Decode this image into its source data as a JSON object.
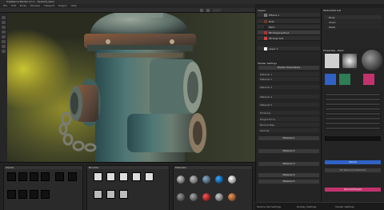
{
  "window": {
    "title": "Substance Painter 2.1.1 - Hydrant_steel"
  },
  "menu": [
    "File",
    "Edit",
    "Mode",
    "Window",
    "Viewport",
    "Plugins",
    "Help"
  ],
  "layers": {
    "title": "Layers",
    "items": [
      {
        "label": "Effects 1"
      },
      {
        "label": "Rust"
      },
      {
        "label": "Paint"
      },
      {
        "label": "PE Dripping Rust"
      },
      {
        "label": "PE Dust Dirt"
      },
      {
        "label": "Layer 1"
      }
    ]
  },
  "texture_set": {
    "title": "TextureSet List",
    "items": [
      "Body",
      "Chain",
      "Pedel"
    ]
  },
  "shader": {
    "title": "Shader Settings",
    "name": "Shader Parameters",
    "sections": [
      "Material 1",
      "Material 2",
      "Material 3",
      "Material 4",
      "Material 5"
    ],
    "rows": [
      "Material 1",
      "Material 2",
      "Material 3",
      "Material 4",
      "Material 5",
      "Emissive",
      "Height Force",
      "Normal Map",
      "Opacity"
    ]
  },
  "properties": {
    "title": "Properties - Paint",
    "button_blue": "Stencil",
    "button_alt": "No Resource Selected",
    "button_pink": "Normal/Height",
    "color_swatches": {
      "blue": "#2f62c4",
      "pink": "#c2336e",
      "green": "#2e7d54"
    }
  },
  "shelf": {
    "title": "Shelf",
    "tabs": [
      "Alphas",
      "Brushes",
      "Materials",
      "Smart materials"
    ]
  },
  "status_tabs": [
    "Texture Set Settings",
    "Display Settings",
    "Shader Settings"
  ]
}
